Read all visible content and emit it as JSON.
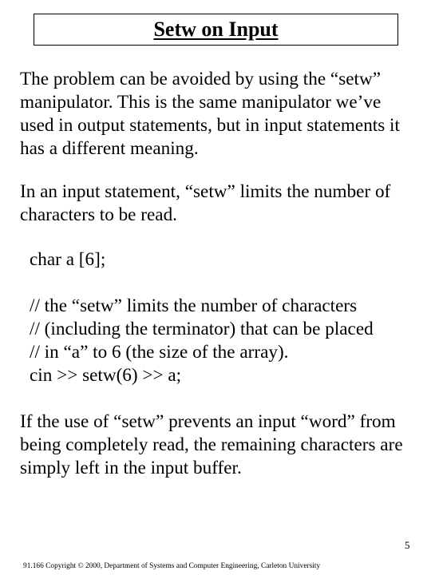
{
  "slide": {
    "title": "Setw on Input",
    "paragraphs": [
      {
        "lines": [
          "The problem can be avoided by using the “setw”",
          "manipulator.  This is the same manipulator we’ve",
          "used in output statements, but in input statements it",
          "has a different meaning."
        ]
      },
      {
        "lines": [
          "In an input statement, “setw” limits the number of",
          "characters to be read."
        ]
      },
      {
        "lines": [
          "If the use of “setw” prevents an input “word” from",
          "being completely read, the remaining characters are",
          "simply left in the input buffer."
        ]
      }
    ],
    "code": {
      "declaration": "char a [6];",
      "lines": [
        "// the “setw” limits the number of characters",
        "// (including the terminator) that can be placed",
        "// in “a” to 6 (the size of the array).",
        "cin >> setw(6) >> a;"
      ]
    },
    "page_number": "5",
    "footer": "91.166 Copyright © 2000, Department of Systems and Computer Engineering, Carleton University"
  }
}
